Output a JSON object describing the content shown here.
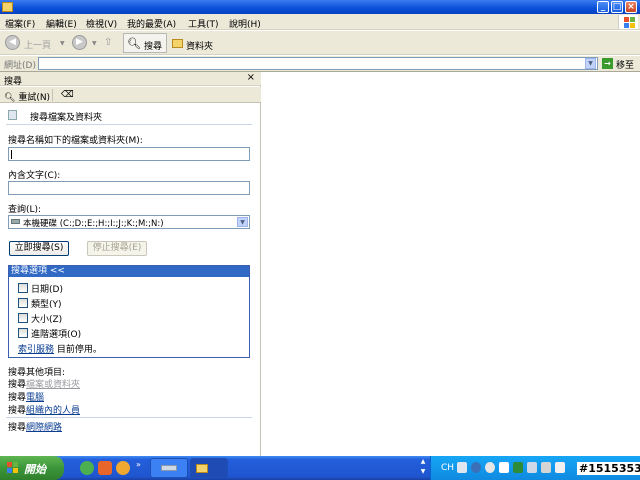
{
  "menu": [
    "檔案(F)",
    "編輯(E)",
    "檢視(V)",
    "我的最愛(A)",
    "工具(T)",
    "說明(H)"
  ],
  "toolbar": {
    "back_label": "上一頁",
    "search_label": "搜尋",
    "folders_label": "資料夾"
  },
  "address": {
    "label": "網址(D)",
    "value": "",
    "go_label": "移至"
  },
  "search_pane": {
    "title": "搜尋",
    "restart_label": "重試(N)",
    "header_text": "搜尋檔案及資料夾",
    "name_label": "搜尋名稱如下的檔案或資料夾(M):",
    "name_value": "",
    "contains_label": "內含文字(C):",
    "contains_value": "",
    "look_in_label": "查詢(L):",
    "look_in_value": "本機硬碟 (C:;D:;E:;H:;I:;J:;K:;M:;N:)",
    "search_now_label": "立即搜尋(S)",
    "stop_label": "停止搜尋(E)",
    "options_header": "搜尋選項 <<",
    "options": [
      {
        "label": "日期(D)",
        "checked": false
      },
      {
        "label": "類型(Y)",
        "checked": false
      },
      {
        "label": "大小(Z)",
        "checked": false
      },
      {
        "label": "進階選項(O)",
        "checked": false
      }
    ],
    "indexing_link": "索引服務",
    "indexing_status": " 目前停用。",
    "other_header": "搜尋其他項目:",
    "other_prefix": "搜尋",
    "other_items": [
      "檔案或資料夾",
      "電腦",
      "組織內的人員"
    ],
    "internet_prefix": "搜尋",
    "internet_link": "網際網路"
  },
  "taskbar": {
    "start_label": "開始",
    "lang": "CH",
    "clock": "#1515353"
  }
}
